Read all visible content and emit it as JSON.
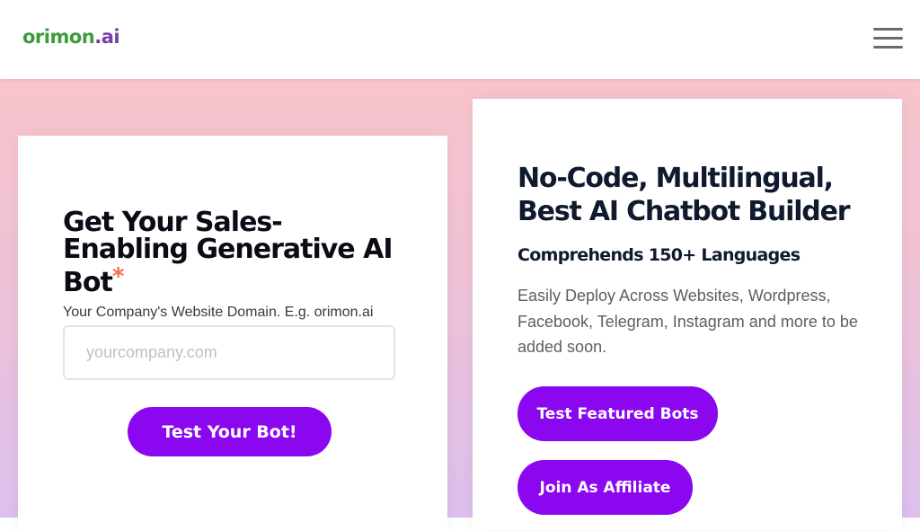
{
  "header": {
    "logo_part1": "orimon",
    "logo_part2": ".ai"
  },
  "form": {
    "title": "Get Your Sales-Enabling Generative AI Bot",
    "required_mark": "*",
    "domain_label": "Your Company's Website Domain. E.g. orimon.ai",
    "domain_placeholder": "yourcompany.com",
    "domain_value": "",
    "submit_label": "Test Your Bot!"
  },
  "features": {
    "title": "No-Code, Multilingual, Best AI Chatbot Builder",
    "subtitle": "Comprehends 150+ Languages",
    "description": "Easily Deploy Across Websites, Wordpress, Facebook, Telegram, Instagram and more to be added soon.",
    "featured_button": "Test Featured Bots",
    "affiliate_button": "Join As Affiliate"
  },
  "colors": {
    "accent": "#8a07f0",
    "logo_green": "#3f9a3c",
    "logo_purple": "#7a3ea1",
    "required": "#f36b54"
  },
  "icons": {
    "menu": "hamburger-menu-icon"
  }
}
